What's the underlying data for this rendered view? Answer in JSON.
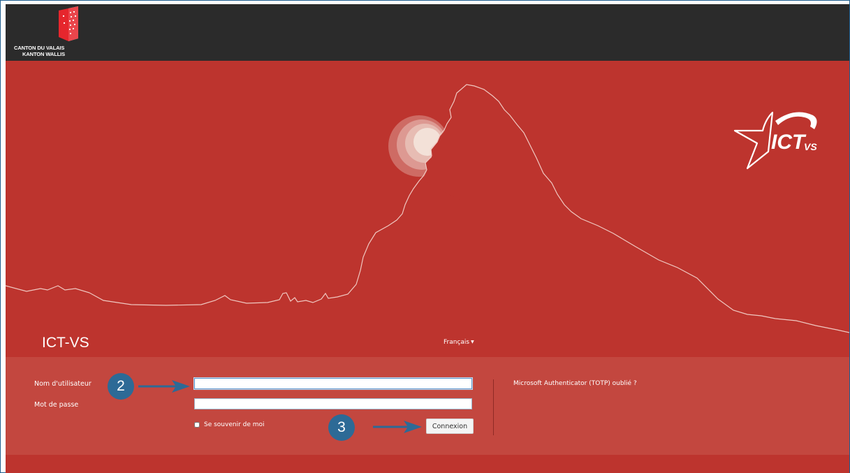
{
  "header": {
    "canton_line1": "CANTON DU VALAIS",
    "canton_line2": "KANTON WALLIS"
  },
  "brand": {
    "app_title": "ICT-VS",
    "logo_main": "ICT",
    "logo_sub": "VS"
  },
  "language": {
    "selected": "Français"
  },
  "login": {
    "username_label": "Nom d'utilisateur",
    "username_value": "",
    "password_label": "Mot de passe",
    "password_value": "",
    "remember_label": "Se souvenir de moi",
    "remember_checked": false,
    "submit_label": "Connexion",
    "totp_link": "Microsoft Authenticator (TOTP) oublié ?"
  },
  "annotations": {
    "step_2": "2",
    "step_3": "3"
  },
  "colors": {
    "header_bg": "#2b2b2b",
    "hero_red": "#bd342e",
    "panel_red": "#c3473f",
    "callout_blue": "#2d6a96"
  }
}
